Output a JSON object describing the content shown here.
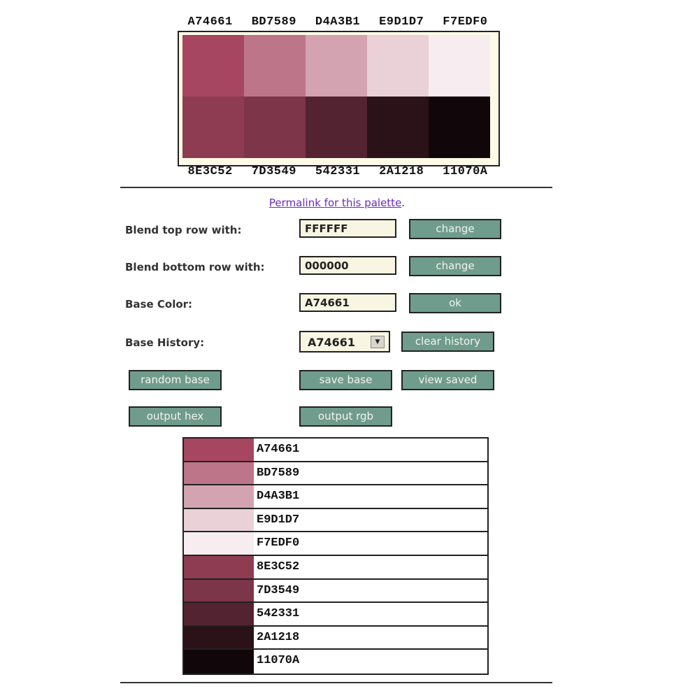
{
  "palette": {
    "top_row": [
      {
        "hex": "A74661",
        "color": "#A74661"
      },
      {
        "hex": "BD7589",
        "color": "#BD7589"
      },
      {
        "hex": "D4A3B1",
        "color": "#D4A3B1"
      },
      {
        "hex": "E9D1D7",
        "color": "#E9D1D7"
      },
      {
        "hex": "F7EDF0",
        "color": "#F7EDF0"
      }
    ],
    "bottom_row": [
      {
        "hex": "8E3C52",
        "color": "#8E3C52"
      },
      {
        "hex": "7D3549",
        "color": "#7D3549"
      },
      {
        "hex": "542331",
        "color": "#542331"
      },
      {
        "hex": "2A1218",
        "color": "#2A1218"
      },
      {
        "hex": "11070A",
        "color": "#11070A"
      }
    ]
  },
  "permalink": {
    "text": "Permalink for this palette",
    "suffix": "."
  },
  "form": {
    "blend_top": {
      "label": "Blend top row with:",
      "value": "FFFFFF",
      "button": "change"
    },
    "blend_bottom": {
      "label": "Blend bottom row with:",
      "value": "000000",
      "button": "change"
    },
    "base_color": {
      "label": "Base Color:",
      "value": "A74661",
      "button": "ok"
    },
    "base_history": {
      "label": "Base History:",
      "selected": "A74661",
      "button": "clear history"
    }
  },
  "buttons": {
    "random_base": "random base",
    "save_base": "save base",
    "view_saved": "view saved",
    "output_hex": "output hex",
    "output_rgb": "output rgb"
  },
  "output_list": [
    {
      "hex": "A74661",
      "color": "#A74661"
    },
    {
      "hex": "BD7589",
      "color": "#BD7589"
    },
    {
      "hex": "D4A3B1",
      "color": "#D4A3B1"
    },
    {
      "hex": "E9D1D7",
      "color": "#E9D1D7"
    },
    {
      "hex": "F7EDF0",
      "color": "#F7EDF0"
    },
    {
      "hex": "8E3C52",
      "color": "#8E3C52"
    },
    {
      "hex": "7D3549",
      "color": "#7D3549"
    },
    {
      "hex": "542331",
      "color": "#542331"
    },
    {
      "hex": "2A1218",
      "color": "#2A1218"
    },
    {
      "hex": "11070A",
      "color": "#11070A"
    }
  ]
}
